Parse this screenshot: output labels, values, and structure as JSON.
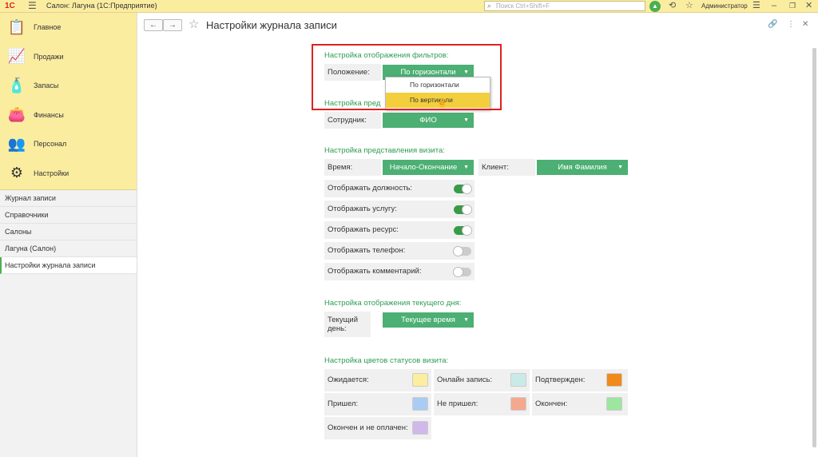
{
  "topbar": {
    "logo": "1С",
    "app_title": "Салон: Лагуна  (1С:Предприятие)",
    "search_placeholder": "Поиск Ctrl+Shift+F",
    "user": "Администратор"
  },
  "sidebar": {
    "sections": [
      {
        "label": "Главное",
        "icon": "clipboard-icon"
      },
      {
        "label": "Продажи",
        "icon": "chart-icon"
      },
      {
        "label": "Запасы",
        "icon": "cosmetics-icon"
      },
      {
        "label": "Финансы",
        "icon": "wallet-icon"
      },
      {
        "label": "Персонал",
        "icon": "people-icon"
      },
      {
        "label": "Настройки",
        "icon": "gear-icon"
      }
    ],
    "nav": [
      {
        "label": "Журнал записи"
      },
      {
        "label": "Справочники"
      },
      {
        "label": "Салоны"
      },
      {
        "label": "Лагуна (Салон)"
      },
      {
        "label": "Настройки журнала записи"
      }
    ]
  },
  "header": {
    "back": "←",
    "forward": "→",
    "title": "Настройки журнала записи"
  },
  "filters": {
    "title": "Настройка отображения фильтров:",
    "position_label": "Положение:",
    "position_value": "По горизонтали",
    "dropdown_options": [
      "По горизонтали",
      "По вертикали"
    ]
  },
  "employee": {
    "title": "Настройка пред",
    "label": "Сотрудник:",
    "value": "ФИО"
  },
  "visit": {
    "title": "Настройка представления визита:",
    "time_label": "Время:",
    "time_value": "Начало-Окончание",
    "client_label": "Клиент:",
    "client_value": "Имя Фамилия",
    "toggles": [
      {
        "label": "Отображать должность:",
        "on": true
      },
      {
        "label": "Отображать услугу:",
        "on": true
      },
      {
        "label": "Отображать ресурс:",
        "on": true
      },
      {
        "label": "Отображать телефон:",
        "on": false
      },
      {
        "label": "Отображать комментарий:",
        "on": false
      }
    ]
  },
  "today": {
    "title": "Настройка отображения текущего дня:",
    "label": "Текущий день:",
    "value": "Текущее время"
  },
  "colors": {
    "title": "Настройка цветов статусов визита:",
    "items": [
      {
        "label": "Ожидается:",
        "color": "#fbee9e"
      },
      {
        "label": "Онлайн запись:",
        "color": "#c8ebe8"
      },
      {
        "label": "Подтвержден:",
        "color": "#f08a1a"
      },
      {
        "label": "Пришел:",
        "color": "#a9cdf2"
      },
      {
        "label": "Не пришел:",
        "color": "#f4a98e"
      },
      {
        "label": "Окончен:",
        "color": "#9de6a0"
      },
      {
        "label": "Окончен и не оплачен:",
        "color": "#d0b8ea"
      }
    ]
  }
}
